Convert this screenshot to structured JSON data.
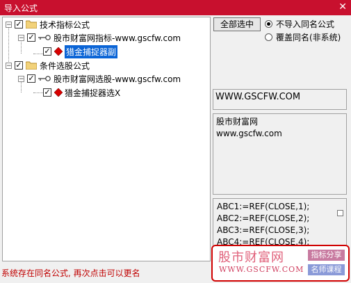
{
  "window": {
    "title": "导入公式",
    "close_glyph": "✕"
  },
  "tree": {
    "nodes": [
      {
        "label": "技术指标公式",
        "checked": "✓",
        "expander": "−",
        "icon": "folder-icon"
      },
      {
        "label": "股市财富网指标-www.gscfw.com",
        "checked": "✓",
        "expander": "−",
        "icon": "key-icon"
      },
      {
        "label": "猎金捕捉器副",
        "checked": "✓",
        "icon": "red-diamond-icon",
        "selected": true
      },
      {
        "label": "条件选股公式",
        "checked": "✓",
        "expander": "−",
        "icon": "folder-icon"
      },
      {
        "label": "股市财富网选股-www.gscfw.com",
        "checked": "✓",
        "expander": "−",
        "icon": "key-icon"
      },
      {
        "label": "猎金捕捉器选X",
        "checked": "✓",
        "icon": "red-diamond-icon"
      }
    ]
  },
  "options": {
    "select_all_label": "全部选中",
    "radio_no_import": "不导入同名公式",
    "radio_overwrite": "覆盖同名(非系统)",
    "selected": "no_import"
  },
  "info": {
    "site": "WWW.GSCFW.COM",
    "desc_line1": "股市财富网",
    "desc_line2": "www.gscfw.com"
  },
  "code": {
    "lines": [
      "ABC1:=REF(CLOSE,1);",
      "ABC2:=REF(CLOSE,2);",
      "ABC3:=REF(CLOSE,3);",
      "ABC4:=REF(CLOSE,4);"
    ]
  },
  "status": {
    "message": "系统存在同名公式, 再次点击可以更名"
  },
  "logo": {
    "name": "股市财富网",
    "url": "WWW.GSCFW.COM",
    "badge1": "指标分享",
    "badge2": "名师课程"
  },
  "colors": {
    "titlebar": "#c8102e",
    "selection": "#0a64d6",
    "status_text": "#c00000"
  }
}
